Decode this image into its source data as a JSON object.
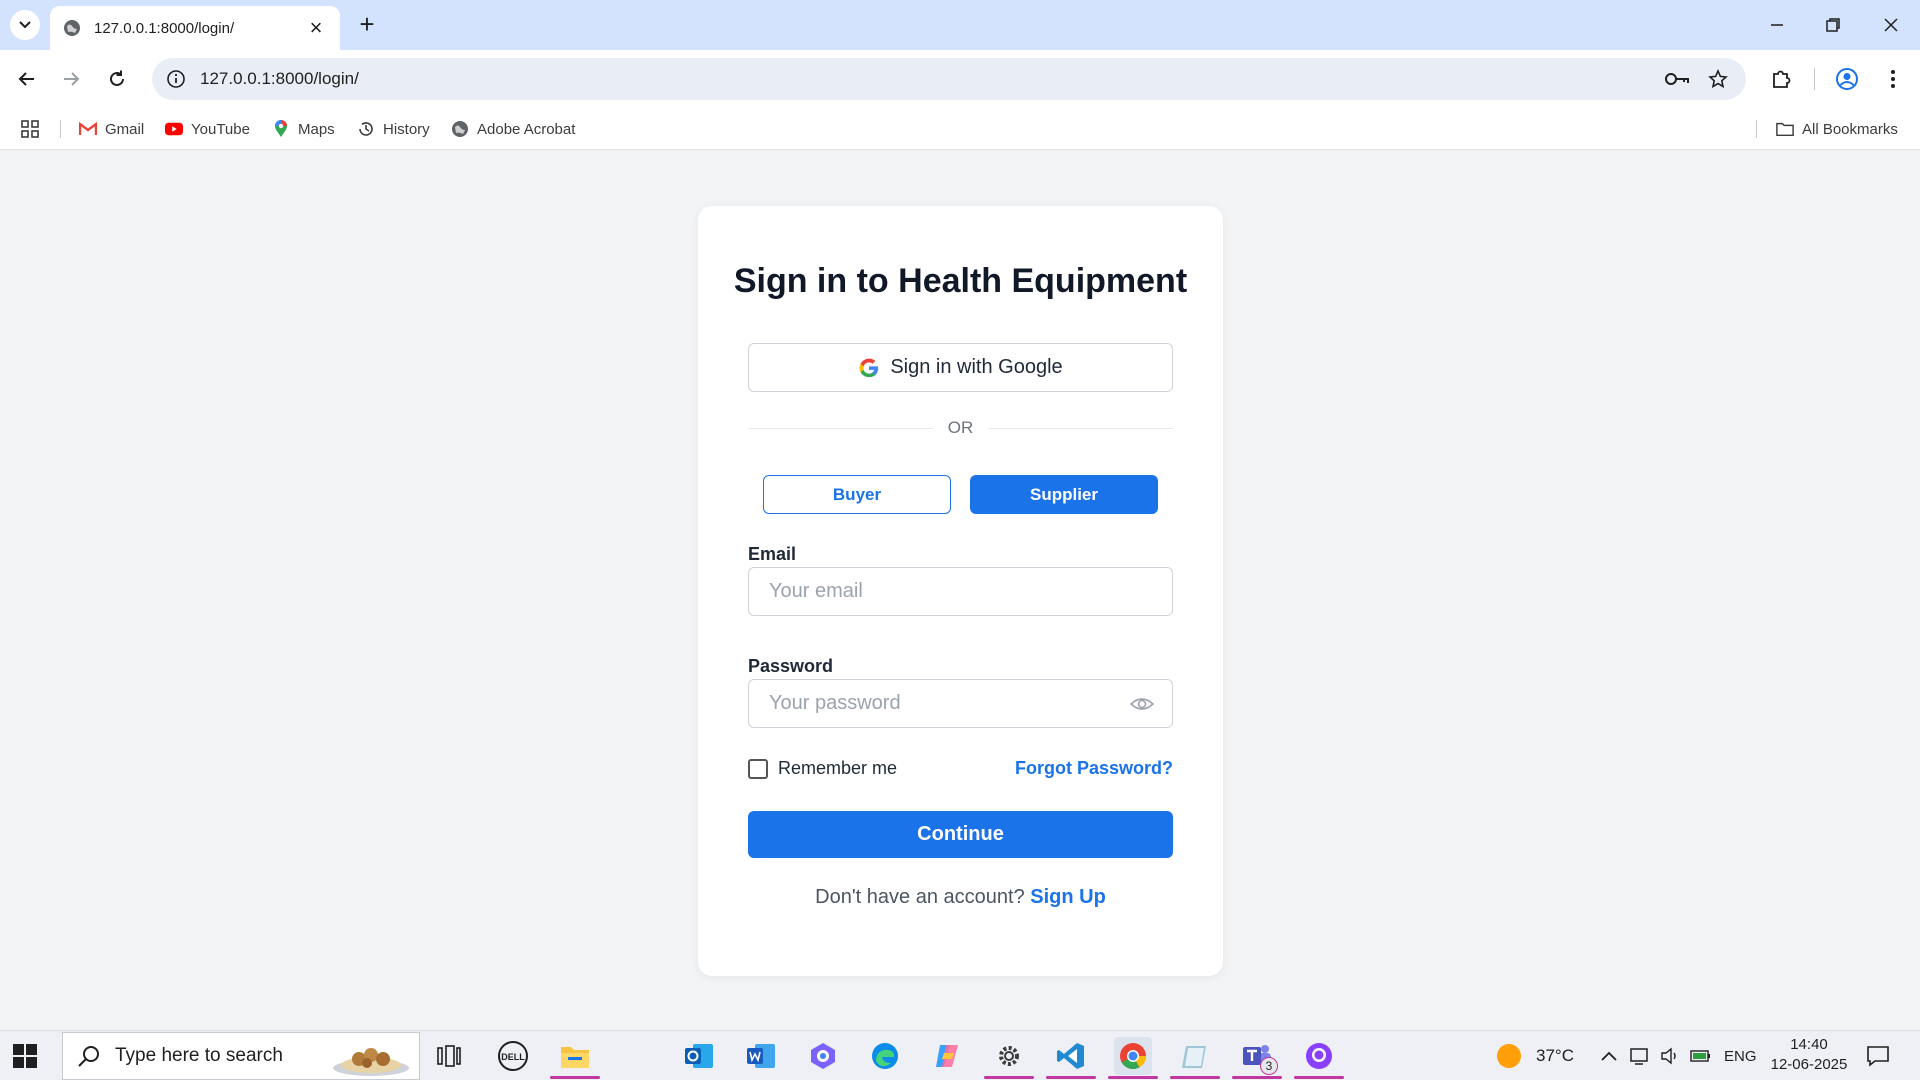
{
  "browser": {
    "tab_title": "127.0.0.1:8000/login/",
    "url": "127.0.0.1:8000/login/",
    "bookmarks": [
      {
        "label": "Gmail",
        "icon": "gmail-icon"
      },
      {
        "label": "YouTube",
        "icon": "youtube-icon"
      },
      {
        "label": "Maps",
        "icon": "maps-icon"
      },
      {
        "label": "History",
        "icon": "history-icon"
      },
      {
        "label": "Adobe Acrobat",
        "icon": "globe-icon"
      }
    ],
    "all_bookmarks": "All Bookmarks"
  },
  "login": {
    "title": "Sign in to Health Equipment",
    "google_label": "Sign in with Google",
    "or_text": "OR",
    "roles": {
      "buyer": "Buyer",
      "supplier": "Supplier",
      "selected": "Supplier"
    },
    "email_label": "Email",
    "email_placeholder": "Your email",
    "password_label": "Password",
    "password_placeholder": "Your password",
    "remember_label": "Remember me",
    "forgot_label": "Forgot Password?",
    "continue_label": "Continue",
    "no_account_text": "Don't have an account?",
    "signup_label": "Sign Up"
  },
  "taskbar": {
    "search_placeholder": "Type here to search",
    "weather": "37°C",
    "language": "ENG",
    "time": "14:40",
    "date": "12-06-2025",
    "teams_badge": "3"
  },
  "colors": {
    "accent": "#1a73e8",
    "tabstrip": "#d3e3fd",
    "page_bg": "#f3f4f6"
  }
}
